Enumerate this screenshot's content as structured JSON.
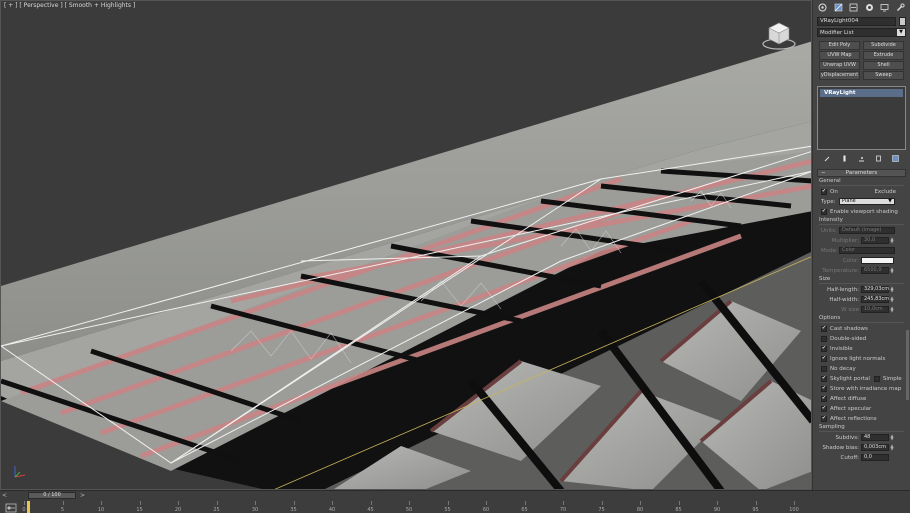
{
  "viewport": {
    "label": "[ + ] [ Perspective ] [ Smooth + Highlights ]"
  },
  "command_panel": {
    "tabs": [
      "create-icon",
      "modify-icon",
      "hierarchy-icon",
      "motion-icon",
      "display-icon",
      "utilities-icon"
    ],
    "object_name": "VRayLight004",
    "object_color": "#c9c9c9",
    "modifier_list": "Modifier List",
    "modifier_buttons": [
      "Edit Poly",
      "Subdivide",
      "UVW Map",
      "Extrude",
      "Unwrap UVW",
      "Shell",
      "yDisplacement",
      "Sweep"
    ],
    "stack_item": "VRayLight",
    "parameters": {
      "title": "Parameters",
      "general": {
        "title": "General",
        "on_label": "On",
        "on_checked": true,
        "exclude_label": "Exclude",
        "type_label": "Type:",
        "type_value": "Plane",
        "enable_viewport_label": "Enable viewport shading",
        "enable_viewport_checked": true
      },
      "intensity": {
        "title": "Intensity",
        "units_label": "Units:",
        "units_value": "Default (image)",
        "multiplier_label": "Multiplier:",
        "multiplier_value": "30,0",
        "mode_label": "Mode:",
        "mode_value": "Color",
        "color_label": "Color:",
        "temperature_label": "Temperature:",
        "temperature_value": "6500,0"
      },
      "size": {
        "title": "Size",
        "half_length_label": "Half-length:",
        "half_length_value": "329,03cm",
        "half_width_label": "Half-width:",
        "half_width_value": "245,83cm",
        "w_size_label": "W size",
        "w_size_value": "10,0cm"
      },
      "options": {
        "title": "Options",
        "items": [
          {
            "label": "Cast shadows",
            "checked": true
          },
          {
            "label": "Double-sided",
            "checked": false
          },
          {
            "label": "Invisible",
            "checked": true
          },
          {
            "label": "Ignore light normals",
            "checked": true
          },
          {
            "label": "No decay",
            "checked": false
          },
          {
            "label": "Skylight portal",
            "checked": true
          },
          {
            "label": "Store with irradiance map",
            "checked": true
          },
          {
            "label": "Affect diffuse",
            "checked": true
          },
          {
            "label": "Affect specular",
            "checked": true
          },
          {
            "label": "Affect reflections",
            "checked": true
          }
        ],
        "simple_label": "Simple"
      },
      "sampling": {
        "title": "Sampling",
        "subdivs_label": "Subdivs:",
        "subdivs_value": "48",
        "shadow_bias_label": "Shadow bias:",
        "shadow_bias_value": "0,003cm",
        "cutoff_label": "Cutoff:",
        "cutoff_value": "0,0"
      }
    }
  },
  "timeline": {
    "slider_label": "0 / 100",
    "prev_label": "<",
    "next_label": ">",
    "ticks": [
      "0",
      "5",
      "10",
      "15",
      "20",
      "25",
      "30",
      "35",
      "40",
      "45",
      "50",
      "55",
      "60",
      "65",
      "70",
      "75",
      "80",
      "85",
      "90",
      "95",
      "100"
    ]
  }
}
